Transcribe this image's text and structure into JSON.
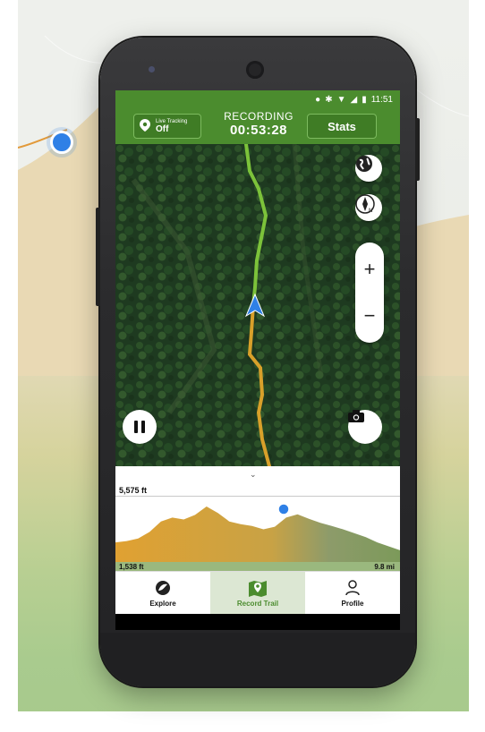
{
  "statusbar": {
    "icons": [
      "location-pin-icon",
      "bluetooth-icon",
      "wifi-icon",
      "signal-icon",
      "battery-icon"
    ],
    "time": "11:51"
  },
  "header": {
    "live_tracking_label": "Live Tracking",
    "live_tracking_value": "Off",
    "recording_label": "RECORDING",
    "elapsed_time": "00:53:28",
    "stats_label": "Stats"
  },
  "map": {
    "zoom_in_label": "+",
    "zoom_out_label": "−",
    "compass_label": "N"
  },
  "elevation": {
    "max_label": "5,575 ft",
    "min_label": "1,538 ft",
    "distance_label": "9.8 mi",
    "profile": [
      0.3,
      0.32,
      0.36,
      0.46,
      0.62,
      0.68,
      0.65,
      0.72,
      0.85,
      0.75,
      0.62,
      0.58,
      0.55,
      0.5,
      0.54,
      0.68,
      0.73,
      0.66,
      0.6,
      0.55,
      0.5,
      0.44,
      0.38,
      0.3,
      0.24,
      0.18
    ]
  },
  "nav": {
    "items": [
      {
        "label": "Explore",
        "icon": "explore-icon"
      },
      {
        "label": "Record Trail",
        "icon": "map-pin-icon"
      },
      {
        "label": "Profile",
        "icon": "person-icon"
      }
    ]
  },
  "colors": {
    "brand_green": "#4b8c2e",
    "track_green": "#7cc23a",
    "track_orange": "#d8a02a",
    "location_blue": "#2f80e6"
  }
}
